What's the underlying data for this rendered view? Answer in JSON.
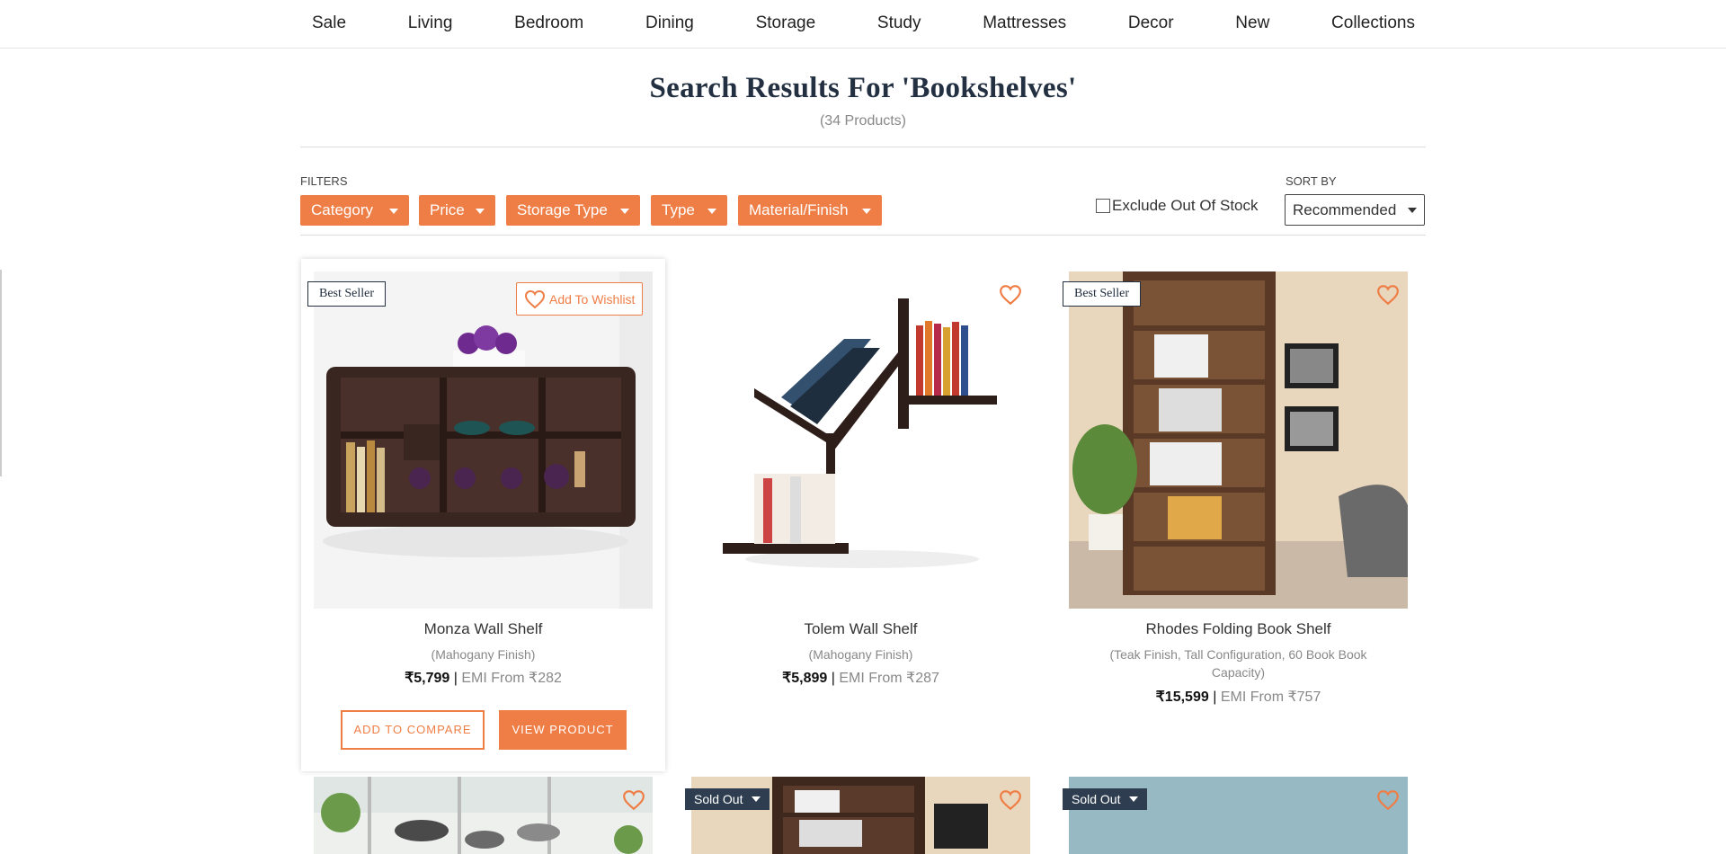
{
  "nav": [
    "Sale",
    "Living",
    "Bedroom",
    "Dining",
    "Storage",
    "Study",
    "Mattresses",
    "Decor",
    "New",
    "Collections"
  ],
  "search": {
    "title": "Search Results For 'Bookshelves'",
    "count": "(34 Products)"
  },
  "filters": {
    "label": "Filters",
    "buttons": [
      "Category",
      "Price",
      "Storage Type",
      "Type",
      "Material/Finish"
    ],
    "exclude_label": "Exclude Out Of Stock",
    "exclude_checked": false
  },
  "sort": {
    "label": "Sort By",
    "selected": "Recommended"
  },
  "colors": {
    "accent": "#ef7e46",
    "navy": "#233041"
  },
  "products": [
    {
      "name": "Monza Wall Shelf",
      "finish": "(Mahogany Finish)",
      "price": "₹5,799",
      "emi": "EMI From ₹282",
      "badge": "Best Seller",
      "wishlist": "Add To Wishlist",
      "compare": "ADD TO COMPARE",
      "view": "VIEW PRODUCT"
    },
    {
      "name": "Tolem Wall Shelf",
      "finish": "(Mahogany Finish)",
      "price": "₹5,899",
      "emi": "EMI From ₹287"
    },
    {
      "name": "Rhodes Folding Book Shelf",
      "finish": "(Teak Finish, Tall Configuration, 60 Book Book Capacity)",
      "price": "₹15,599",
      "emi": "EMI From ₹757",
      "badge": "Best Seller"
    },
    {
      "name": ""
    },
    {
      "soldout": "Sold Out"
    },
    {
      "soldout": "Sold Out"
    }
  ]
}
